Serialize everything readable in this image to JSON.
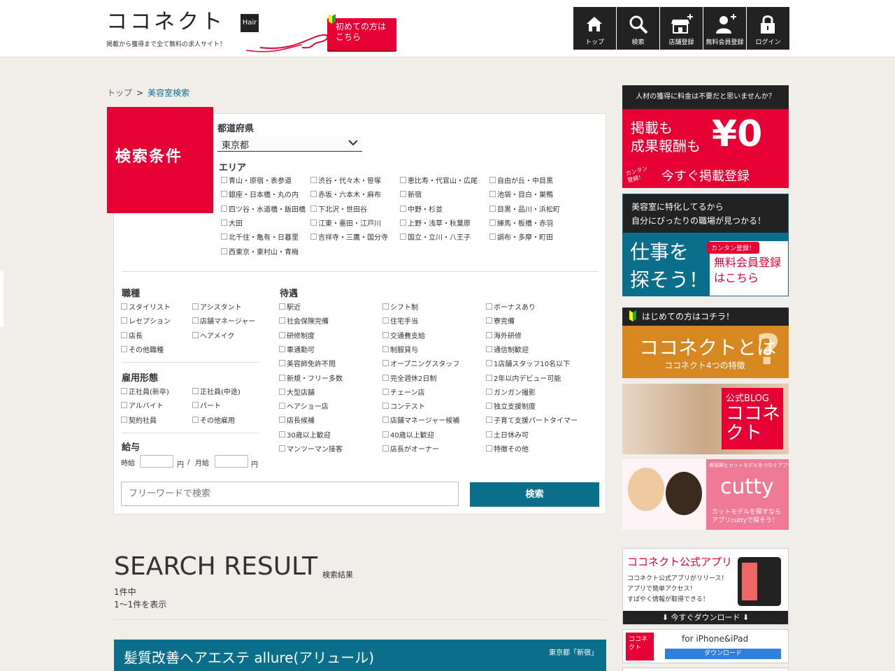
{
  "header": {
    "logo_text": "ココネクト",
    "logo_badge": "Hair",
    "tagline": "掲載から獲得まで全て無料の求人サイト！",
    "first_time_button": "初めての方は\nこちら",
    "nav": [
      {
        "label": "トップ",
        "icon": "home-icon"
      },
      {
        "label": "検索",
        "icon": "search-icon"
      },
      {
        "label": "店舗登録",
        "icon": "store-add-icon"
      },
      {
        "label": "無料会員登録",
        "icon": "user-add-icon"
      },
      {
        "label": "ログイン",
        "icon": "lock-icon"
      }
    ]
  },
  "breadcrumb": {
    "home": "トップ",
    "separator": ">",
    "current": "美容室検索"
  },
  "search": {
    "tag": "検索条件",
    "prefecture_label": "都道府県",
    "prefecture_value": "東京都",
    "area_label": "エリア",
    "areas": [
      "青山・原宿・表参道",
      "渋谷・代々木・笹塚",
      "恵比寿・代官山・広尾",
      "自由が丘・中目黒",
      "銀座・日本橋・丸の内",
      "赤坂・六本木・麻布",
      "新宿",
      "池袋・目白・巣鴨",
      "四ツ谷・水道橋・飯田橋",
      "下北沢・世田谷",
      "中野・杉並",
      "目黒・品川・浜松町",
      "大田",
      "江東・墨田・江戸川",
      "上野・浅草・秋葉原",
      "練馬・板橋・赤羽",
      "北千住・亀有・日暮里",
      "吉祥寺・三鷹・国分寺",
      "国立・立川・八王子",
      "調布・多摩・町田",
      "西東京・東村山・青梅"
    ],
    "job_label": "職種",
    "jobs": [
      "スタイリスト",
      "アシスタント",
      "レセプション",
      "店舗マネージャー",
      "店長",
      "ヘアメイク",
      "その他職種"
    ],
    "employment_label": "雇用形態",
    "employment": [
      "正社員(新卒)",
      "正社員(中途)",
      "アルバイト",
      "パート",
      "契約社員",
      "その他雇用"
    ],
    "salary_label": "給与",
    "salary_hourly": "時給",
    "salary_monthly": "月給",
    "salary_unit": "円",
    "salary_slash": "/",
    "benefits_label": "待遇",
    "benefits": [
      "駅近",
      "シフト制",
      "ボーナスあり",
      "社会保険完備",
      "住宅手当",
      "寮完備",
      "研修制度",
      "交通費支給",
      "海外研修",
      "車通勤可",
      "制服貸与",
      "通信制歓迎",
      "美容師免許不問",
      "オープニングスタッフ",
      "1店舗スタッフ10名以下",
      "新規・フリー多数",
      "完全週休2日制",
      "2年以内デビュー可能",
      "大型店舗",
      "チェーン店",
      "ガンガン撮影",
      "ヘアショー店",
      "コンテスト",
      "独立支援制度",
      "店長候補",
      "店舗マネージャー候補",
      "子育て支援パートタイマー",
      "30歳以上歓迎",
      "40歳以上歓迎",
      "土日休み可",
      "マンツーマン接客",
      "店長がオーナー",
      "特徴その他"
    ],
    "freeword_placeholder": "フリーワードで検索",
    "search_button": "検索"
  },
  "results": {
    "title": "SEARCH RESULT",
    "subtitle": "検索結果",
    "total": "1件中",
    "range": "1〜1件を表示",
    "items": [
      {
        "name": "髪質改善ヘアエステ allure(アリュール)",
        "location": "東京都「新宿」"
      }
    ]
  },
  "sidebar": {
    "banner1": {
      "top": "人材の獲得に料金は不要だと思いませんか？",
      "line1": "掲載も",
      "line2": "成果報酬も",
      "zero": "¥0",
      "small": "カンタン\n登録！",
      "cta": "今すぐ掲載登録"
    },
    "banner2": {
      "top1": "美容室に特化してるから",
      "top2": "自分にぴったりの職場が見つかる！",
      "big1": "仕事を",
      "big2": "探そう！",
      "pill": "カンタン登録！",
      "right1": "無料会員登録",
      "right2": "はこちら"
    },
    "banner3": {
      "top": "はじめての方はコチラ！",
      "big": "ココネクトとは",
      "small": "ココネクト4つの特徴",
      "q": "?"
    },
    "banner4": {
      "l1": "公式BLOG",
      "l2": "ココネ",
      "l3": "クト"
    },
    "banner5": {
      "l0": "美容師とカットモデルをつなぐアプリ",
      "brand": "cutty",
      "l2a": "カットモデルを探すなら",
      "l2b": "アプリcuttyで探そう！"
    },
    "banner6": {
      "title": "ココネクト公式アプリ",
      "t1": "ココネクト公式アプリがリリース！",
      "t2": "アプリで簡単アクセス！",
      "t3": "すばやく情報が取得できる！",
      "bar": "⬇ 今すぐダウンロード ⬇"
    },
    "banner7": {
      "icon_text": "ココネクト",
      "label": "for iPhone&iPad",
      "button": "ダウンロード"
    }
  },
  "colors": {
    "accent_red": "#e60033",
    "accent_teal": "#0b6f8c",
    "dark": "#222222",
    "background": "#f1eeea"
  }
}
